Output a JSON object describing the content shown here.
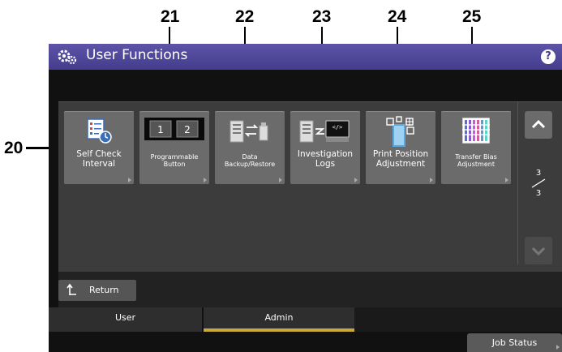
{
  "callouts": {
    "c20": "20",
    "c21": "21",
    "c22": "22",
    "c23": "23",
    "c24": "24",
    "c25": "25"
  },
  "header": {
    "title": "User Functions",
    "help": "?"
  },
  "tiles": [
    {
      "label": "Self Check\nInterval",
      "icon": "calendar-clock-icon"
    },
    {
      "label": "Programmable\nButton",
      "icon": "programmable-keys-icon",
      "key1": "1",
      "key2": "2"
    },
    {
      "label": "Data\nBackup/Restore",
      "icon": "backup-restore-icon"
    },
    {
      "label": "Investigation\nLogs",
      "icon": "investigation-logs-icon",
      "code": "</>"
    },
    {
      "label": "Print Position\nAdjustment",
      "icon": "print-position-icon"
    },
    {
      "label": "Transfer Bias\nAdjustment",
      "icon": "transfer-bias-icon"
    }
  ],
  "pagination": {
    "current": "3",
    "total": "3"
  },
  "return_button": {
    "label": "Return"
  },
  "tabs": [
    {
      "label": "User",
      "active": false
    },
    {
      "label": "Admin",
      "active": true
    }
  ],
  "job_status": {
    "label": "Job Status"
  },
  "colors": {
    "title_bar": "#4c4498",
    "active_tab_underline": "#c9a93c",
    "tile": "#6b6b6b"
  }
}
